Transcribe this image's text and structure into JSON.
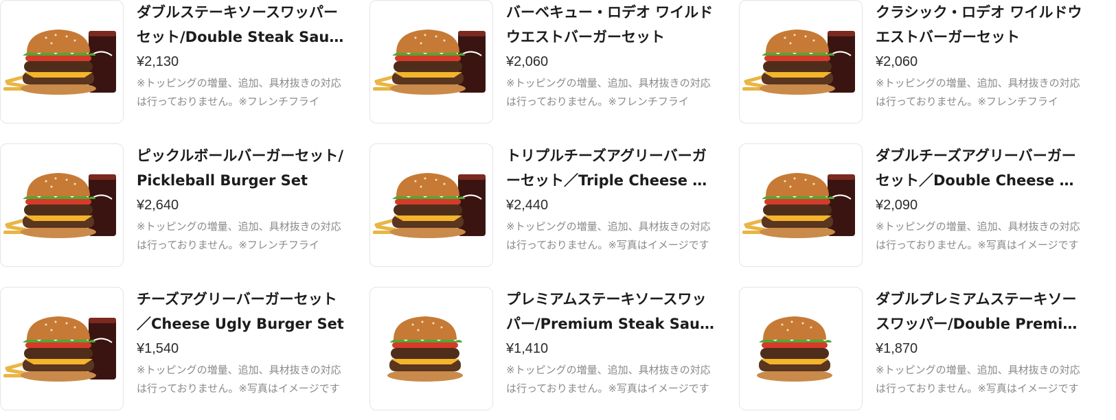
{
  "menu_items": [
    {
      "name": "ダブルステーキソースワッパーセット/Double Steak Sauce Whopper Set",
      "price": "¥2,130",
      "description": "※トッピングの増量、追加、具材抜きの対応は行っておりません。※フレンチフライ",
      "image": "burger-set-with-cola-and-fries-image"
    },
    {
      "name": "バーベキュー・ロデオ ワイルドウエストバーガーセット",
      "price": "¥2,060",
      "description": "※トッピングの増量、追加、具材抜きの対応は行っておりません。※フレンチフライ",
      "image": "burger-set-with-cola-and-fries-image"
    },
    {
      "name": "クラシック・ロデオ ワイルドウエストバーガーセット",
      "price": "¥2,060",
      "description": "※トッピングの増量、追加、具材抜きの対応は行っておりません。※フレンチフライ",
      "image": "burger-set-with-cola-and-fries-image"
    },
    {
      "name": "ピックルボールバーガーセット/Pickleball Burger Set",
      "price": "¥2,640",
      "description": "※トッピングの増量、追加、具材抜きの対応は行っておりません。※フレンチフライ",
      "image": "burger-set-with-cola-and-fries-image"
    },
    {
      "name": "トリプルチーズアグリーバーガーセット／Triple Cheese Ugly Burger Set",
      "price": "¥2,440",
      "description": "※トッピングの増量、追加、具材抜きの対応は行っておりません。※写真はイメージです",
      "image": "burger-set-with-cola-and-fries-image"
    },
    {
      "name": "ダブルチーズアグリーバーガーセット／Double Cheese Ugly Burger Set",
      "price": "¥2,090",
      "description": "※トッピングの増量、追加、具材抜きの対応は行っておりません。※写真はイメージです",
      "image": "burger-set-with-cola-and-fries-image"
    },
    {
      "name": "チーズアグリーバーガーセット／Cheese Ugly Burger Set",
      "price": "¥1,540",
      "description": "※トッピングの増量、追加、具材抜きの対応は行っておりません。※写真はイメージです",
      "image": "burger-set-with-cola-and-fries-image"
    },
    {
      "name": "プレミアムステーキソースワッパー/Premium Steak Sauce Whopper",
      "price": "¥1,410",
      "description": "※トッピングの増量、追加、具材抜きの対応は行っておりません。※写真はイメージです",
      "image": "single-burger-image"
    },
    {
      "name": "ダブルプレミアムステーキソースワッパー/Double Premium Steak Sauce Whopper",
      "price": "¥1,870",
      "description": "※トッピングの増量、追加、具材抜きの対応は行っておりません。※写真はイメージです",
      "image": "single-burger-image"
    }
  ]
}
